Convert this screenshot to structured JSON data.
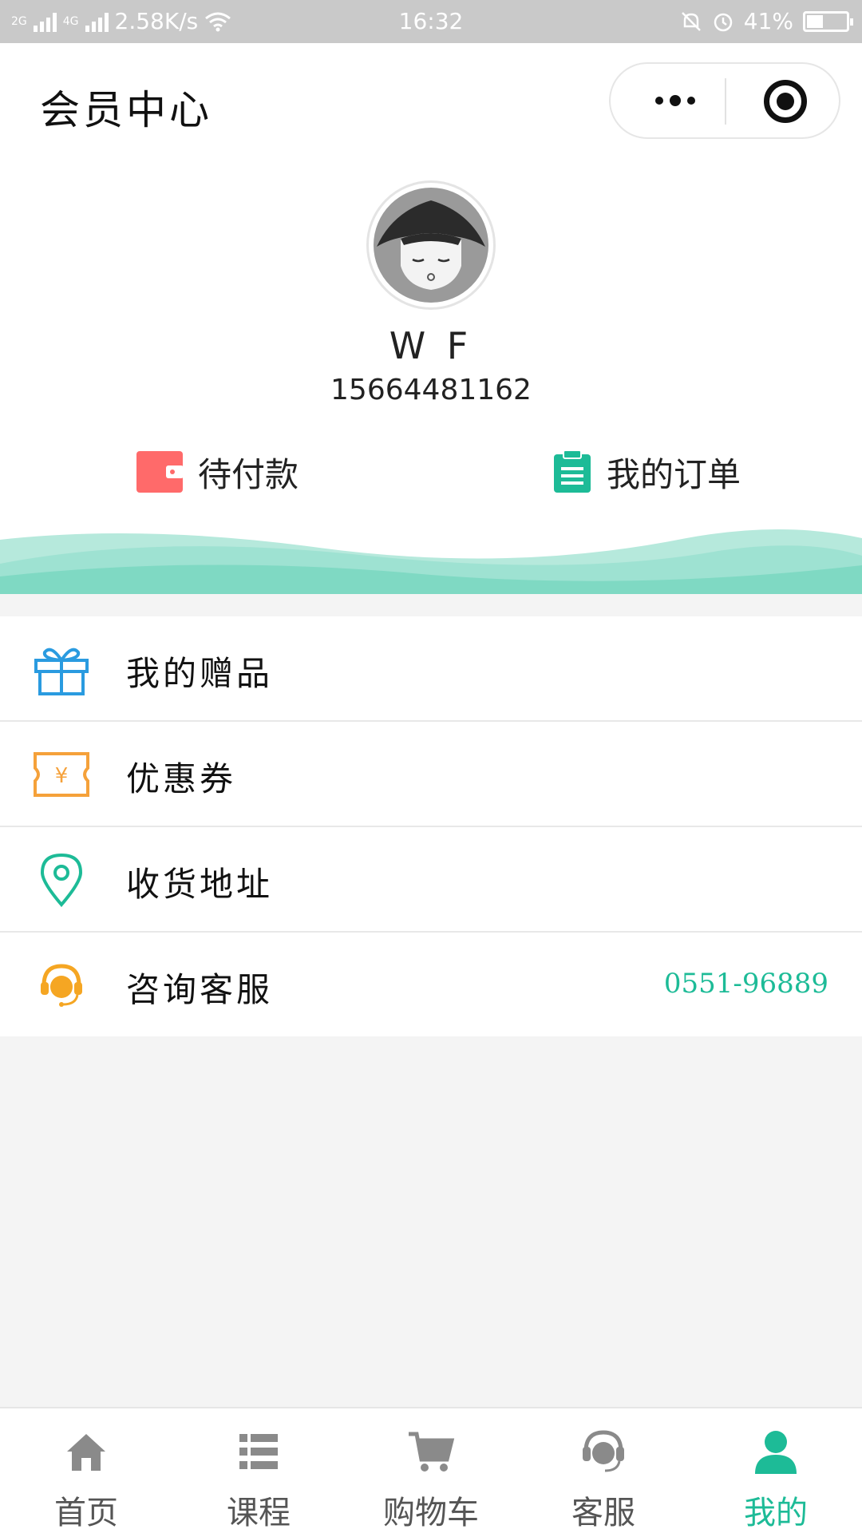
{
  "status_bar": {
    "network_left": "2G",
    "network_right": "4G",
    "speed": "2.58K/s",
    "time": "16:32",
    "battery": "41%",
    "battery_level": 0.41
  },
  "header": {
    "title": "会员中心"
  },
  "profile": {
    "name": "W F",
    "phone": "15664481162",
    "quick_actions": [
      {
        "label": "待付款",
        "icon": "wallet-icon",
        "color": "#ff6a6a"
      },
      {
        "label": "我的订单",
        "icon": "clipboard-icon",
        "color": "#1dbb97"
      }
    ]
  },
  "menu": {
    "items": [
      {
        "label": "我的赠品",
        "icon": "gift-icon",
        "color": "#2a9be0",
        "value": ""
      },
      {
        "label": "优惠券",
        "icon": "coupon-icon",
        "color": "#f5a13a",
        "value": ""
      },
      {
        "label": "收货地址",
        "icon": "location-pin-icon",
        "color": "#1dbb97",
        "value": ""
      },
      {
        "label": "咨询客服",
        "icon": "headset-icon",
        "color": "#f5a623",
        "value": "0551-96889"
      }
    ]
  },
  "tab_bar": {
    "tabs": [
      {
        "label": "首页",
        "icon": "home-icon",
        "active": false
      },
      {
        "label": "课程",
        "icon": "list-icon",
        "active": false
      },
      {
        "label": "购物车",
        "icon": "cart-icon",
        "active": false
      },
      {
        "label": "客服",
        "icon": "headset-icon",
        "active": false
      },
      {
        "label": "我的",
        "icon": "user-icon",
        "active": true
      }
    ],
    "active_color": "#1dbb97",
    "inactive_color": "#8a8a8a"
  },
  "colors": {
    "accent": "#1dbb97",
    "wave_light": "#b6e9dc",
    "wave_dark": "#7fd9c3"
  }
}
